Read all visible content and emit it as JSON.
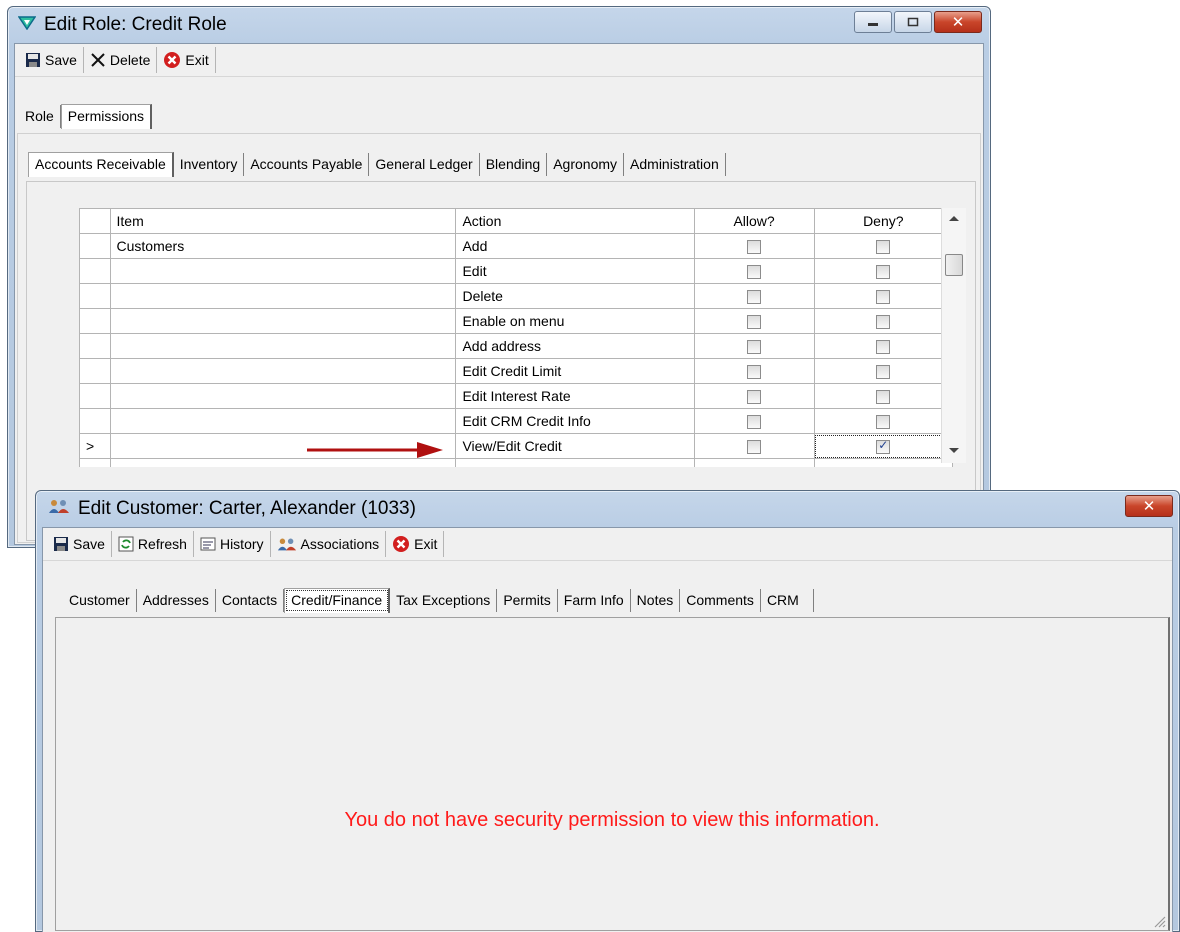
{
  "role_window": {
    "title": "Edit Role: Credit Role",
    "toolbar": {
      "save": "Save",
      "delete": "Delete",
      "exit": "Exit"
    },
    "tabs": [
      "Role",
      "Permissions"
    ],
    "active_tab": "Permissions",
    "module_tabs": [
      "Accounts Receivable",
      "Inventory",
      "Accounts Payable",
      "General Ledger",
      "Blending",
      "Agronomy",
      "Administration"
    ],
    "active_module_tab": "Accounts Receivable",
    "grid": {
      "headers": {
        "item": "Item",
        "action": "Action",
        "allow": "Allow?",
        "deny": "Deny?"
      },
      "current_row_marker": ">",
      "rows": [
        {
          "item": "Customers",
          "action": "Add",
          "allow": false,
          "deny": false
        },
        {
          "item": "",
          "action": "Edit",
          "allow": false,
          "deny": false
        },
        {
          "item": "",
          "action": "Delete",
          "allow": false,
          "deny": false
        },
        {
          "item": "",
          "action": "Enable on menu",
          "allow": false,
          "deny": false
        },
        {
          "item": "",
          "action": "Add address",
          "allow": false,
          "deny": false
        },
        {
          "item": "",
          "action": "Edit Credit Limit",
          "allow": false,
          "deny": false
        },
        {
          "item": "",
          "action": "Edit Interest Rate",
          "allow": false,
          "deny": false
        },
        {
          "item": "",
          "action": "Edit CRM Credit Info",
          "allow": false,
          "deny": false
        },
        {
          "item": "",
          "action": "View/Edit Credit",
          "allow": false,
          "deny": true
        }
      ]
    }
  },
  "customer_window": {
    "title": "Edit Customer: Carter, Alexander (1033)",
    "toolbar": {
      "save": "Save",
      "refresh": "Refresh",
      "history": "History",
      "associations": "Associations",
      "exit": "Exit"
    },
    "tabs": [
      "Customer",
      "Addresses",
      "Contacts",
      "Credit/Finance",
      "Tax Exceptions",
      "Permits",
      "Farm Info",
      "Notes",
      "Comments",
      "CRM"
    ],
    "active_tab": "Credit/Finance",
    "message": "You do not have security permission to view this information."
  },
  "colors": {
    "error_text": "#ff1a1a",
    "arrow": "#b01010",
    "titlebar": "#b9cde4"
  }
}
